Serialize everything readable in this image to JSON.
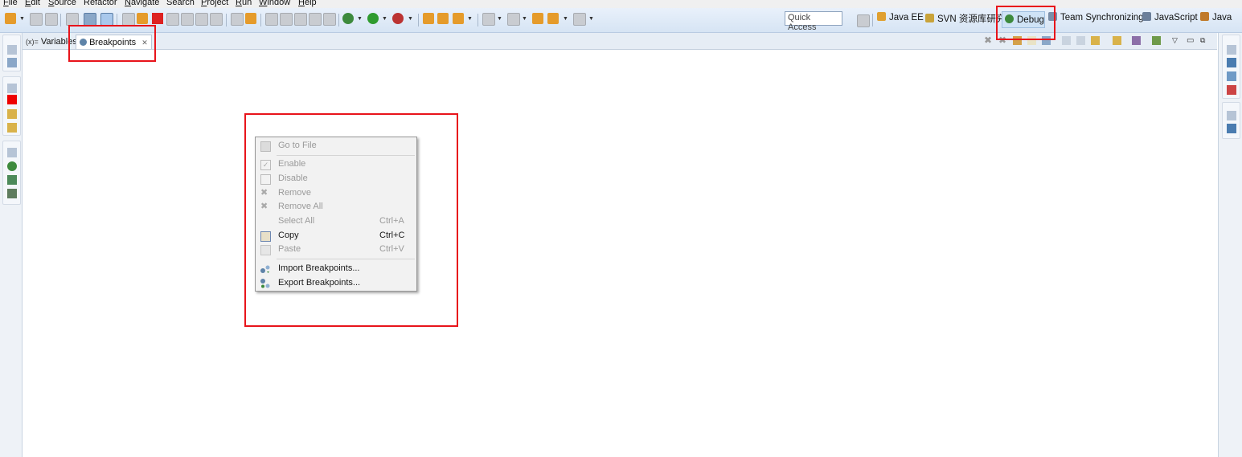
{
  "menubar": {
    "items": [
      {
        "label": "File",
        "ul": "F",
        "rest": "ile"
      },
      {
        "label": "Edit",
        "ul": "E",
        "rest": "dit"
      },
      {
        "label": "Source",
        "ul": "S",
        "rest": "ource"
      },
      {
        "label": "Refactor",
        "ul": "",
        "rest": "Refactor"
      },
      {
        "label": "Navigate",
        "ul": "N",
        "rest": "avigate"
      },
      {
        "label": "Search",
        "ul": "",
        "rest": "Search"
      },
      {
        "label": "Project",
        "ul": "P",
        "rest": "roject"
      },
      {
        "label": "Run",
        "ul": "R",
        "rest": "un"
      },
      {
        "label": "Window",
        "ul": "W",
        "rest": "indow"
      },
      {
        "label": "Help",
        "ul": "H",
        "rest": "elp"
      }
    ]
  },
  "toolbar": {
    "quick_access_placeholder": "Quick Access"
  },
  "perspectives": {
    "items": [
      {
        "label": "Java EE",
        "icon": "java-ee-perspective-icon"
      },
      {
        "label": "SVN 资源库研究",
        "icon": "svn-perspective-icon"
      },
      {
        "label": "Debug",
        "icon": "debug-perspective-icon",
        "active": true
      },
      {
        "label": "Team Synchronizing",
        "icon": "team-sync-perspective-icon"
      },
      {
        "label": "JavaScript",
        "icon": "javascript-perspective-icon"
      },
      {
        "label": "Java",
        "icon": "java-perspective-icon"
      }
    ]
  },
  "views": {
    "tabs": [
      {
        "label": "Variables",
        "prefix": "(x)="
      },
      {
        "label": "Breakpoints",
        "active": true,
        "close": "✕"
      }
    ]
  },
  "context_menu": {
    "items": [
      {
        "label": "Go to File",
        "shortcut": "",
        "enabled": false,
        "icon": "go-to-file-icon"
      },
      {
        "label": "Enable",
        "shortcut": "",
        "enabled": false,
        "icon": "enable-check-icon"
      },
      {
        "label": "Disable",
        "shortcut": "",
        "enabled": false,
        "icon": "disable-box-icon"
      },
      {
        "label": "Remove",
        "shortcut": "",
        "enabled": false,
        "icon": "remove-x-icon"
      },
      {
        "label": "Remove All",
        "shortcut": "",
        "enabled": false,
        "icon": "remove-all-icon"
      },
      {
        "label": "Select All",
        "shortcut": "Ctrl+A",
        "enabled": false,
        "icon": ""
      },
      {
        "label": "Copy",
        "shortcut": "Ctrl+C",
        "enabled": true,
        "icon": "copy-icon"
      },
      {
        "label": "Paste",
        "shortcut": "Ctrl+V",
        "enabled": false,
        "icon": "paste-icon"
      },
      {
        "label": "Import Breakpoints...",
        "shortcut": "",
        "enabled": true,
        "icon": "import-breakpoints-icon"
      },
      {
        "label": "Export Breakpoints...",
        "shortcut": "",
        "enabled": true,
        "icon": "export-breakpoints-icon"
      }
    ]
  },
  "colors": {
    "annotation_red": "#e8141b",
    "toolbar_bg": "#d6e4f4",
    "active_perspective_bg": "#cfe3f6"
  }
}
